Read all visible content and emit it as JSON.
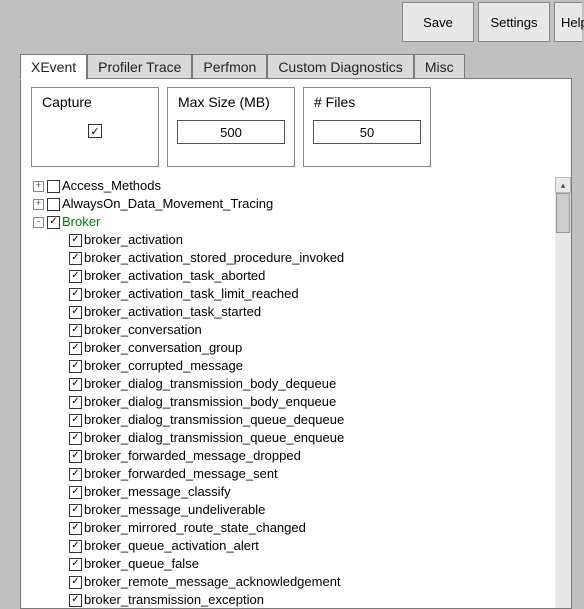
{
  "toolbar": {
    "save": "Save",
    "settings": "Settings",
    "help": "Help"
  },
  "tabs": [
    {
      "label": "XEvent",
      "active": true
    },
    {
      "label": "Profiler Trace",
      "active": false
    },
    {
      "label": "Perfmon",
      "active": false
    },
    {
      "label": "Custom Diagnostics",
      "active": false
    },
    {
      "label": "Misc",
      "active": false
    }
  ],
  "fields": {
    "capture": {
      "label": "Capture",
      "checked": true
    },
    "maxsize": {
      "label": "Max Size (MB)",
      "value": "500"
    },
    "files": {
      "label": "# Files",
      "value": "50"
    }
  },
  "tree": [
    {
      "level": 0,
      "expander": "+",
      "checked": false,
      "label": "Access_Methods"
    },
    {
      "level": 0,
      "expander": "+",
      "checked": false,
      "label": "AlwaysOn_Data_Movement_Tracing"
    },
    {
      "level": 0,
      "expander": "-",
      "checked": true,
      "label": "Broker",
      "green": true
    },
    {
      "level": 1,
      "checked": true,
      "label": "broker_activation"
    },
    {
      "level": 1,
      "checked": true,
      "label": "broker_activation_stored_procedure_invoked"
    },
    {
      "level": 1,
      "checked": true,
      "label": "broker_activation_task_aborted"
    },
    {
      "level": 1,
      "checked": true,
      "label": "broker_activation_task_limit_reached"
    },
    {
      "level": 1,
      "checked": true,
      "label": "broker_activation_task_started"
    },
    {
      "level": 1,
      "checked": true,
      "label": "broker_conversation"
    },
    {
      "level": 1,
      "checked": true,
      "label": "broker_conversation_group"
    },
    {
      "level": 1,
      "checked": true,
      "label": "broker_corrupted_message"
    },
    {
      "level": 1,
      "checked": true,
      "label": "broker_dialog_transmission_body_dequeue"
    },
    {
      "level": 1,
      "checked": true,
      "label": "broker_dialog_transmission_body_enqueue"
    },
    {
      "level": 1,
      "checked": true,
      "label": "broker_dialog_transmission_queue_dequeue"
    },
    {
      "level": 1,
      "checked": true,
      "label": "broker_dialog_transmission_queue_enqueue"
    },
    {
      "level": 1,
      "checked": true,
      "label": "broker_forwarded_message_dropped"
    },
    {
      "level": 1,
      "checked": true,
      "label": "broker_forwarded_message_sent"
    },
    {
      "level": 1,
      "checked": true,
      "label": "broker_message_classify"
    },
    {
      "level": 1,
      "checked": true,
      "label": "broker_message_undeliverable"
    },
    {
      "level": 1,
      "checked": true,
      "label": "broker_mirrored_route_state_changed"
    },
    {
      "level": 1,
      "checked": true,
      "label": "broker_queue_activation_alert"
    },
    {
      "level": 1,
      "checked": true,
      "label": "broker_queue_false"
    },
    {
      "level": 1,
      "checked": true,
      "label": "broker_remote_message_acknowledgement"
    },
    {
      "level": 1,
      "checked": true,
      "label": "broker_transmission_exception"
    }
  ]
}
